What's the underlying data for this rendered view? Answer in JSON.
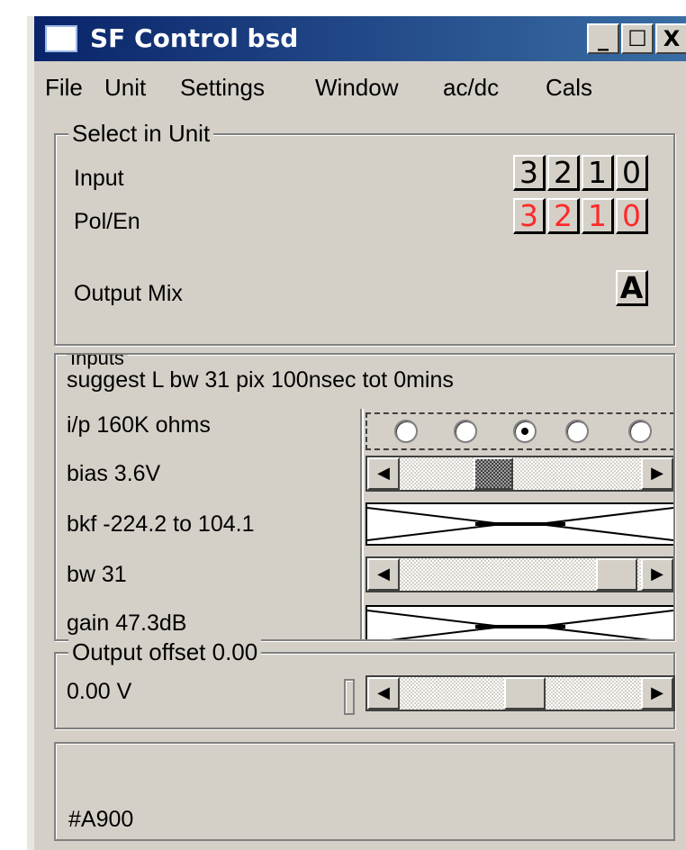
{
  "window": {
    "title": "SF Control bsd",
    "minimize_label": "_",
    "maximize_label": "☐",
    "close_label": "X"
  },
  "menu": [
    "File",
    "Unit",
    "Settings",
    "Window",
    "ac/dc",
    "Cals"
  ],
  "select_unit": {
    "legend": "Select in Unit",
    "input_label": "Input",
    "input_digits": [
      "3",
      "2",
      "1",
      "0"
    ],
    "pol_label": "Pol/En",
    "pol_digits": [
      "3",
      "2",
      "1",
      "0"
    ],
    "pol_color": "#ff2a2a",
    "output_mix_label": "Output Mix",
    "output_mix_value": "A"
  },
  "inputs": {
    "legend": "Inputs",
    "suggest": "suggest L bw 31 pix 100nsec tot 0mins",
    "impedance": "i/p 160K ohms",
    "impedance_selected_index": 2,
    "impedance_option_count": 5,
    "bias": "bias 3.6V",
    "bias_position": 0.43,
    "bkf": "bkf -224.2 to 104.1",
    "bw": "bw 31",
    "bw_position": 0.95,
    "gain": "gain 47.3dB"
  },
  "output": {
    "legend": "Output offset 0.00",
    "value": "0.00 V",
    "position": 0.5
  },
  "status": {
    "text": "#A900"
  },
  "icons": {
    "left_arrow": "◀",
    "right_arrow": "▶"
  }
}
